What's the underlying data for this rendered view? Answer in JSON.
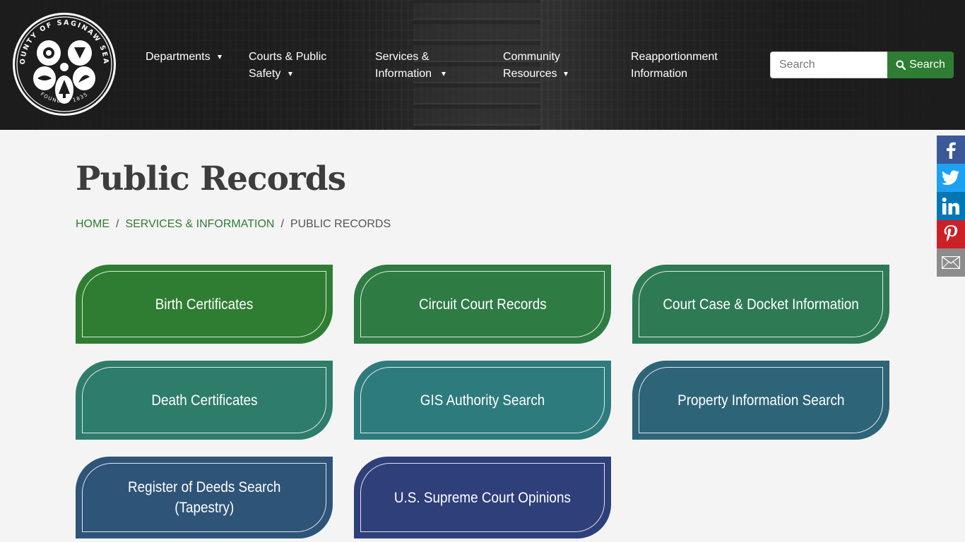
{
  "logo": {
    "seal_text_top": "COUNTY OF SAGINAW SEAL",
    "seal_text_bottom": "FOUNDED 1835"
  },
  "nav": {
    "items": [
      {
        "label": "Departments",
        "has_dropdown": true
      },
      {
        "label": "Courts & Public\nSafety",
        "has_dropdown": true
      },
      {
        "label": "Services &\nInformation",
        "has_dropdown": true
      },
      {
        "label": "Community\nResources",
        "has_dropdown": true
      },
      {
        "label": "Reapportionment\nInformation",
        "has_dropdown": false
      }
    ]
  },
  "search": {
    "placeholder": "Search",
    "button_label": "Search",
    "button_color": "#2e7d32"
  },
  "page": {
    "title": "Public Records"
  },
  "breadcrumb": {
    "home": "HOME",
    "section": "SERVICES & INFORMATION",
    "current": "PUBLIC RECORDS"
  },
  "cards": [
    {
      "label": "Birth Certificates",
      "color": "#2e7d32"
    },
    {
      "label": "Circuit Court Records",
      "color": "#2e7b44"
    },
    {
      "label": "Court Case & Docket Information",
      "color": "#2e7a55"
    },
    {
      "label": "Death Certificates",
      "color": "#2e7c6a"
    },
    {
      "label": "GIS Authority Search",
      "color": "#2e7b7d"
    },
    {
      "label": "Property Information Search",
      "color": "#2e6478"
    },
    {
      "label": "Register of Deeds Search\n(Tapestry)",
      "color": "#2e5478"
    },
    {
      "label": "U.S. Supreme Court Opinions",
      "color": "#2e3f7a"
    }
  ],
  "social": [
    {
      "name": "facebook",
      "color": "#3b5998"
    },
    {
      "name": "twitter",
      "color": "#1da1f2"
    },
    {
      "name": "linkedin",
      "color": "#0077b5"
    },
    {
      "name": "pinterest",
      "color": "#cb2027"
    },
    {
      "name": "email",
      "color": "#8c8c8c"
    }
  ]
}
